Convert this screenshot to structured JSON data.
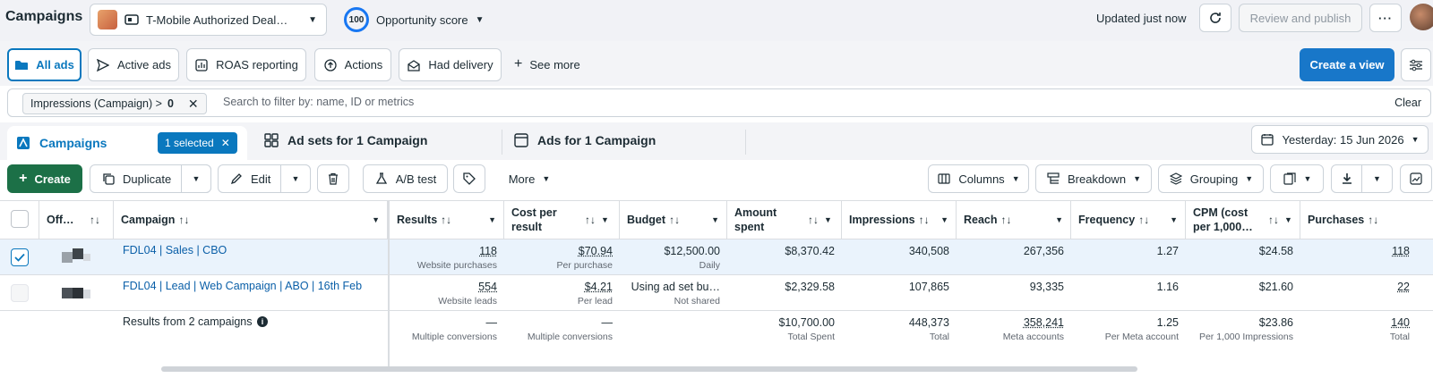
{
  "header": {
    "title": "Campaigns",
    "account_name": "T-Mobile Authorized Deal…",
    "opportunity_score": "100",
    "opportunity_label": "Opportunity score",
    "updated": "Updated just now",
    "review_label": "Review and publish"
  },
  "views": {
    "all_ads": "All ads",
    "active_ads": "Active ads",
    "roas": "ROAS reporting",
    "actions": "Actions",
    "had_delivery": "Had delivery",
    "see_more": "See more",
    "create_view": "Create a view"
  },
  "filter": {
    "chip_label": "Impressions (Campaign) >",
    "chip_value": "0",
    "placeholder": "Search to filter by: name, ID or metrics",
    "clear": "Clear"
  },
  "levels": {
    "campaigns": "Campaigns",
    "selected": "1 selected",
    "adsets": "Ad sets for 1 Campaign",
    "ads": "Ads for 1 Campaign",
    "date": "Yesterday: 15 Jun 2026"
  },
  "toolbar": {
    "create": "Create",
    "duplicate": "Duplicate",
    "edit": "Edit",
    "ab_test": "A/B test",
    "more": "More",
    "columns": "Columns",
    "breakdown": "Breakdown",
    "grouping": "Grouping"
  },
  "table": {
    "columns": {
      "off": "Off…",
      "campaign": "Campaign",
      "results": "Results",
      "cost_per_result": "Cost per result",
      "budget": "Budget",
      "amount_spent": "Amount spent",
      "impressions": "Impressions",
      "reach": "Reach",
      "frequency": "Frequency",
      "cpm": "CPM (cost per 1,000…",
      "purchases": "Purchases"
    },
    "rows": [
      {
        "name": "FDL04 | Sales | CBO",
        "results": "118",
        "results_sub": "Website purchases",
        "cost": "$70.94",
        "cost_sub": "Per purchase",
        "budget": "$12,500.00",
        "budget_sub": "Daily",
        "spent": "$8,370.42",
        "impressions": "340,508",
        "reach": "267,356",
        "frequency": "1.27",
        "cpm": "$24.58",
        "purchases": "118"
      },
      {
        "name": "FDL04 | Lead | Web Campaign | ABO | 16th Feb",
        "results": "554",
        "results_sub": "Website leads",
        "cost": "$4.21",
        "cost_sub": "Per lead",
        "budget": "Using ad set bu…",
        "budget_sub": "Not shared",
        "spent": "$2,329.58",
        "impressions": "107,865",
        "reach": "93,335",
        "frequency": "1.16",
        "cpm": "$21.60",
        "purchases": "22"
      }
    ],
    "summary": {
      "label": "Results from 2 campaigns",
      "results": "—",
      "results_sub": "Multiple conversions",
      "cost": "—",
      "cost_sub": "Multiple conversions",
      "spent": "$10,700.00",
      "spent_sub": "Total Spent",
      "impressions": "448,373",
      "impressions_sub": "Total",
      "reach": "358,241",
      "reach_sub": "Meta accounts",
      "frequency": "1.25",
      "frequency_sub": "Per Meta account",
      "cpm": "$23.86",
      "cpm_sub": "Per 1,000 Impressions",
      "purchases": "140",
      "purchases_sub": "Total"
    }
  },
  "colors": {
    "primary_blue": "#0a78be",
    "create_green": "#1c7047",
    "selected_row": "#eaf3fc"
  }
}
